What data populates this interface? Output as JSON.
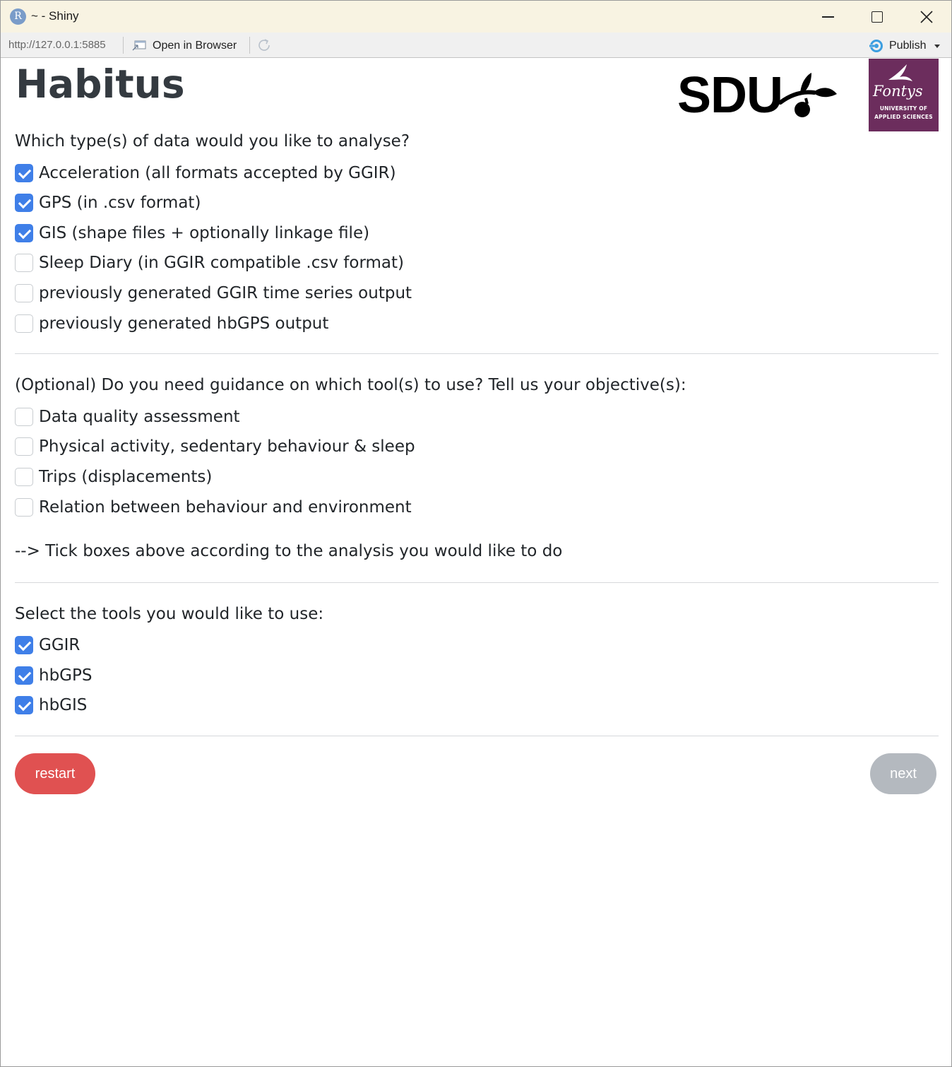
{
  "window": {
    "title": "~ - Shiny",
    "url": "http://127.0.0.1:5885",
    "open_in_browser": "Open in Browser",
    "publish": "Publish"
  },
  "header": {
    "title": "Habitus",
    "sdu_logo": "SDU",
    "fontys_logo": {
      "name": "Fontys",
      "line1": "UNIVERSITY OF",
      "line2": "APPLIED SCIENCES"
    }
  },
  "data_types": {
    "question": "Which type(s) of data would you like to analyse?",
    "options": [
      {
        "label": "Acceleration (all formats accepted by GGIR)",
        "checked": true
      },
      {
        "label": "GPS (in .csv format)",
        "checked": true
      },
      {
        "label": "GIS (shape files + optionally linkage file)",
        "checked": true
      },
      {
        "label": "Sleep Diary (in GGIR compatible .csv format)",
        "checked": false
      },
      {
        "label": "previously generated GGIR time series output",
        "checked": false
      },
      {
        "label": "previously generated hbGPS output",
        "checked": false
      }
    ]
  },
  "objectives": {
    "question": "(Optional) Do you need guidance on which tool(s) to use? Tell us your objective(s):",
    "options": [
      {
        "label": "Data quality assessment",
        "checked": false
      },
      {
        "label": "Physical activity, sedentary behaviour & sleep",
        "checked": false
      },
      {
        "label": "Trips (displacements)",
        "checked": false
      },
      {
        "label": "Relation between behaviour and environment",
        "checked": false
      }
    ],
    "hint": "--> Tick boxes above according to the analysis you would like to do"
  },
  "tools": {
    "question": "Select the tools you would like to use:",
    "options": [
      {
        "label": "GGIR",
        "checked": true
      },
      {
        "label": "hbGPS",
        "checked": true
      },
      {
        "label": "hbGIS",
        "checked": true
      }
    ]
  },
  "buttons": {
    "restart": "restart",
    "next": "next"
  },
  "colors": {
    "checkbox_checked": "#3f7fe8",
    "restart_button": "#e05151",
    "next_button_disabled": "#b4b9bf",
    "fontys_purple": "#6c2d5d",
    "title_bar": "#f8f3e2"
  }
}
